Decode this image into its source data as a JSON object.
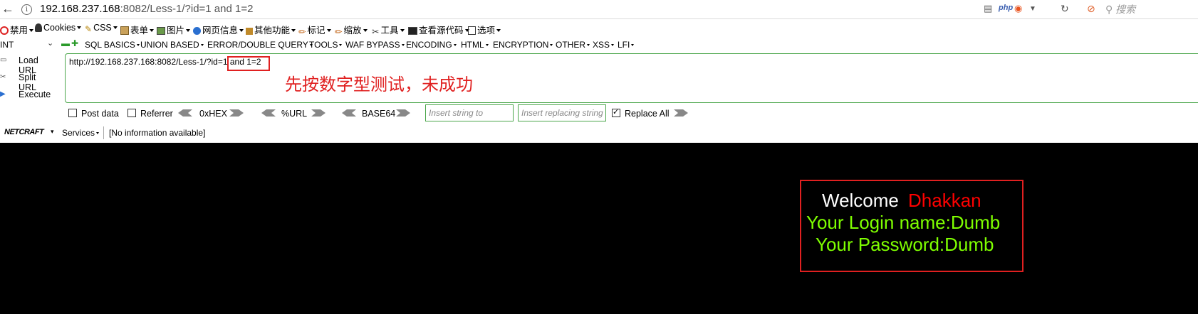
{
  "address_bar": {
    "url_host": "192.168.237.168",
    "url_rest": ":8082/Less-1/?id=1 and 1=2",
    "search_placeholder": "搜索",
    "php_label": "php",
    "info_glyph": "i",
    "back_glyph": "←"
  },
  "toolbar": {
    "items": [
      "禁用",
      "Cookies",
      "CSS",
      "表单",
      "图片",
      "网页信息",
      "其他功能",
      "标记",
      "缩放",
      "工具",
      "查看源代码",
      "选项"
    ]
  },
  "hackbar": {
    "select_value": "INT",
    "menu": [
      "SQL BASICS",
      "UNION BASED",
      "ERROR/DOUBLE QUERY",
      "TOOLS",
      "WAF BYPASS",
      "ENCODING",
      "HTML",
      "ENCRYPTION",
      "OTHER",
      "XSS",
      "LFI"
    ],
    "load_url": "Load URL",
    "split_url": "Split URL",
    "execute": "Execute",
    "url_prefix": "http://192.168.237.168:8082/Less-1/?id=1",
    "url_injection": " and 1=2",
    "annotation": "先按数字型测试，未成功",
    "post_data": "Post data",
    "referrer": "Referrer",
    "hex": "0xHEX",
    "url_enc": "%URL",
    "base64": "BASE64",
    "insert_string_placeholder": "Insert string to replace",
    "insert_replacing_placeholder": "Insert replacing string",
    "replace_all": "Replace All",
    "replace_all_checked": true
  },
  "netcraft": {
    "logo": "NETCRAFT",
    "services": "Services",
    "info": "[No information available]"
  },
  "page": {
    "welcome": "Welcome",
    "user": "Dhakkan",
    "login_name": "Your Login name:Dumb",
    "password": "Your Password:Dumb",
    "colors": {
      "background": "#000000",
      "welcome": "#ffffff",
      "user": "#ff0000",
      "info": "#7fff00",
      "border": "#e02020"
    }
  }
}
